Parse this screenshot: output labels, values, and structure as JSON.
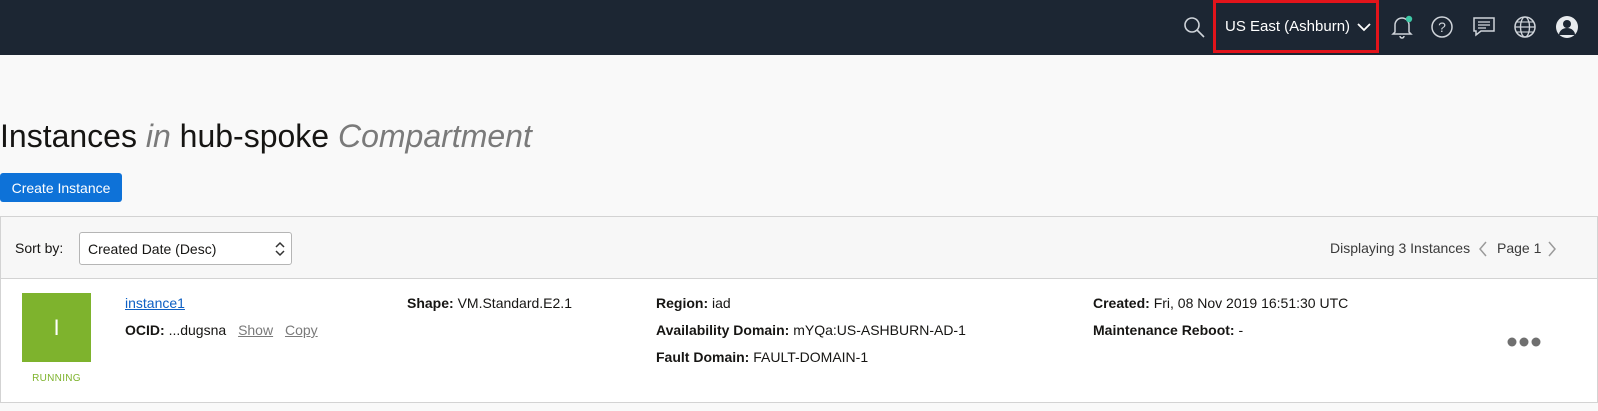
{
  "header": {
    "region_label": "US East (Ashburn)",
    "icons": [
      "search-icon",
      "bell-icon",
      "help-icon",
      "chat-icon",
      "globe-icon",
      "user-icon"
    ],
    "notification_dot_color": "#3ec9a7",
    "highlight_color": "#e2141b"
  },
  "page": {
    "title_part1": "Instances",
    "title_in": "in",
    "title_compartment": "hub-spoke",
    "title_suffix": "Compartment",
    "create_button": "Create Instance"
  },
  "toolbar": {
    "sort_label": "Sort by:",
    "sort_value": "Created Date (Desc)",
    "displaying": "Displaying 3 Instances",
    "page_label": "Page 1"
  },
  "instances": [
    {
      "initial": "I",
      "status": "RUNNING",
      "name": "instance1",
      "ocid_label": "OCID:",
      "ocid_value": "...dugsna",
      "show_label": "Show",
      "copy_label": "Copy",
      "shape_label": "Shape:",
      "shape_value": "VM.Standard.E2.1",
      "region_label": "Region:",
      "region_value": "iad",
      "ad_label": "Availability Domain:",
      "ad_value": "mYQa:US-ASHBURN-AD-1",
      "fd_label": "Fault Domain:",
      "fd_value": "FAULT-DOMAIN-1",
      "created_label": "Created:",
      "created_value": "Fri, 08 Nov 2019 16:51:30 UTC",
      "maint_label": "Maintenance Reboot:",
      "maint_value": "-"
    }
  ]
}
